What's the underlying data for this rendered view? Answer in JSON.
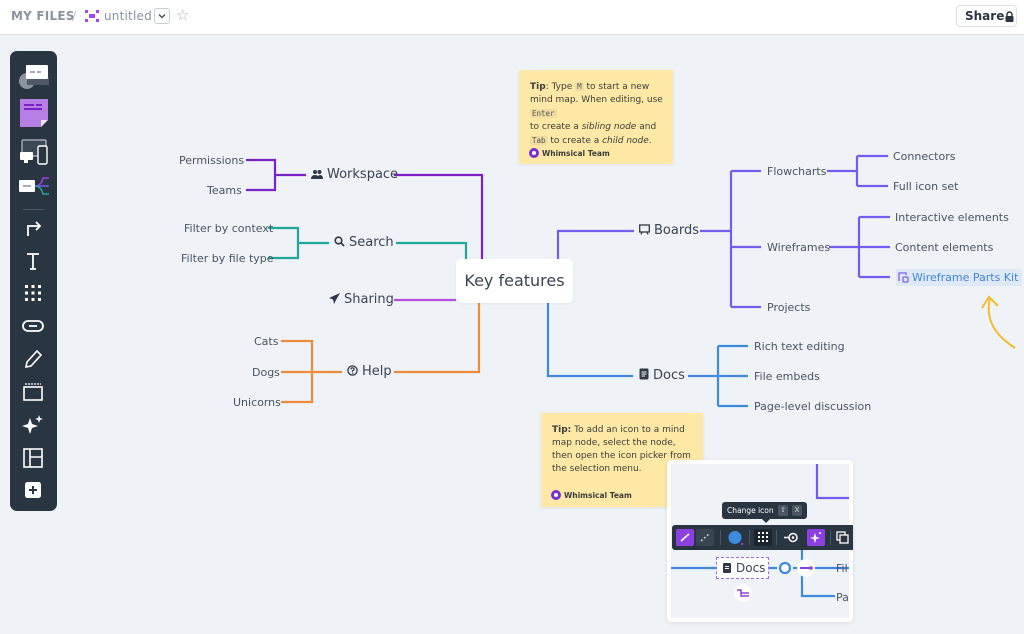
{
  "header": {
    "breadcrumb_root": "MY FILES",
    "breadcrumb_separator": "/",
    "file_title": "untitled",
    "share_label": "Share"
  },
  "toolbar": {
    "tools": [
      {
        "name": "flowchart-tool",
        "icon": "flowchart-icon"
      },
      {
        "name": "sticky-note-tool",
        "icon": "sticky-note-icon"
      },
      {
        "name": "wireframe-tool",
        "icon": "wireframe-icon"
      },
      {
        "name": "mind-map-tool",
        "icon": "mind-map-icon"
      },
      {
        "name": "connector-tool",
        "icon": "arrow-icon"
      },
      {
        "name": "text-tool",
        "icon": "text-icon"
      },
      {
        "name": "icon-tool",
        "icon": "grid-icon"
      },
      {
        "name": "link-tool",
        "icon": "link-icon"
      },
      {
        "name": "pen-tool",
        "icon": "pencil-icon"
      },
      {
        "name": "section-tool",
        "icon": "section-icon"
      },
      {
        "name": "ai-tool",
        "icon": "sparkle-icon"
      },
      {
        "name": "template-tool",
        "icon": "layout-icon"
      },
      {
        "name": "insert-tool",
        "icon": "plus-icon"
      }
    ]
  },
  "mindmap": {
    "root": "Key features",
    "colors": {
      "workspace": "#7a22c7",
      "search": "#1fa89a",
      "sharing": "#b84fdd",
      "help": "#ee8a3d",
      "boards": "#6f5ef0",
      "docs": "#3d8ae0"
    },
    "branches": {
      "workspace": {
        "label": "Workspace",
        "icon": "users-icon",
        "children": [
          "Permissions",
          "Teams"
        ]
      },
      "search": {
        "label": "Search",
        "icon": "search-icon",
        "children": [
          "Filter by context",
          "Filter by file type"
        ]
      },
      "sharing": {
        "label": "Sharing",
        "icon": "paper-plane-icon",
        "children": []
      },
      "help": {
        "label": "Help",
        "icon": "question-circle-icon",
        "children": [
          "Cats",
          "Dogs",
          "Unicorns"
        ]
      },
      "boards": {
        "label": "Boards",
        "icon": "whiteboard-icon",
        "children": [
          {
            "label": "Flowcharts",
            "children": [
              "Connectors",
              "Full icon set"
            ]
          },
          {
            "label": "Wireframes",
            "children": [
              "Interactive elements",
              "Content elements",
              "Wireframe Parts Kit"
            ]
          },
          {
            "label": "Projects",
            "children": []
          }
        ]
      },
      "docs": {
        "label": "Docs",
        "icon": "document-icon",
        "children": [
          "Rich text editing",
          "File embeds",
          "Page-level discussion"
        ]
      }
    }
  },
  "tips": [
    {
      "prefix": "Tip",
      "segments": [
        ": Type ",
        "M",
        " to start a new mind map. When editing, use ",
        "Enter",
        " to create a ",
        "sibling node",
        " and ",
        "Tab",
        " to create a ",
        "child node",
        "."
      ],
      "author": "Whimsical Team"
    },
    {
      "prefix": "Tip:",
      "text": " To add an icon to a mind map node, select the node, then open the icon picker from the selection menu.",
      "author": "Whimsical Team"
    }
  ],
  "preview": {
    "tooltip_label": "Change icon",
    "tooltip_keys": [
      "⇧",
      "X"
    ],
    "node_label": "Docs",
    "cut_children": [
      "Fil",
      "Pa"
    ],
    "accent": "#8e3fe0"
  }
}
